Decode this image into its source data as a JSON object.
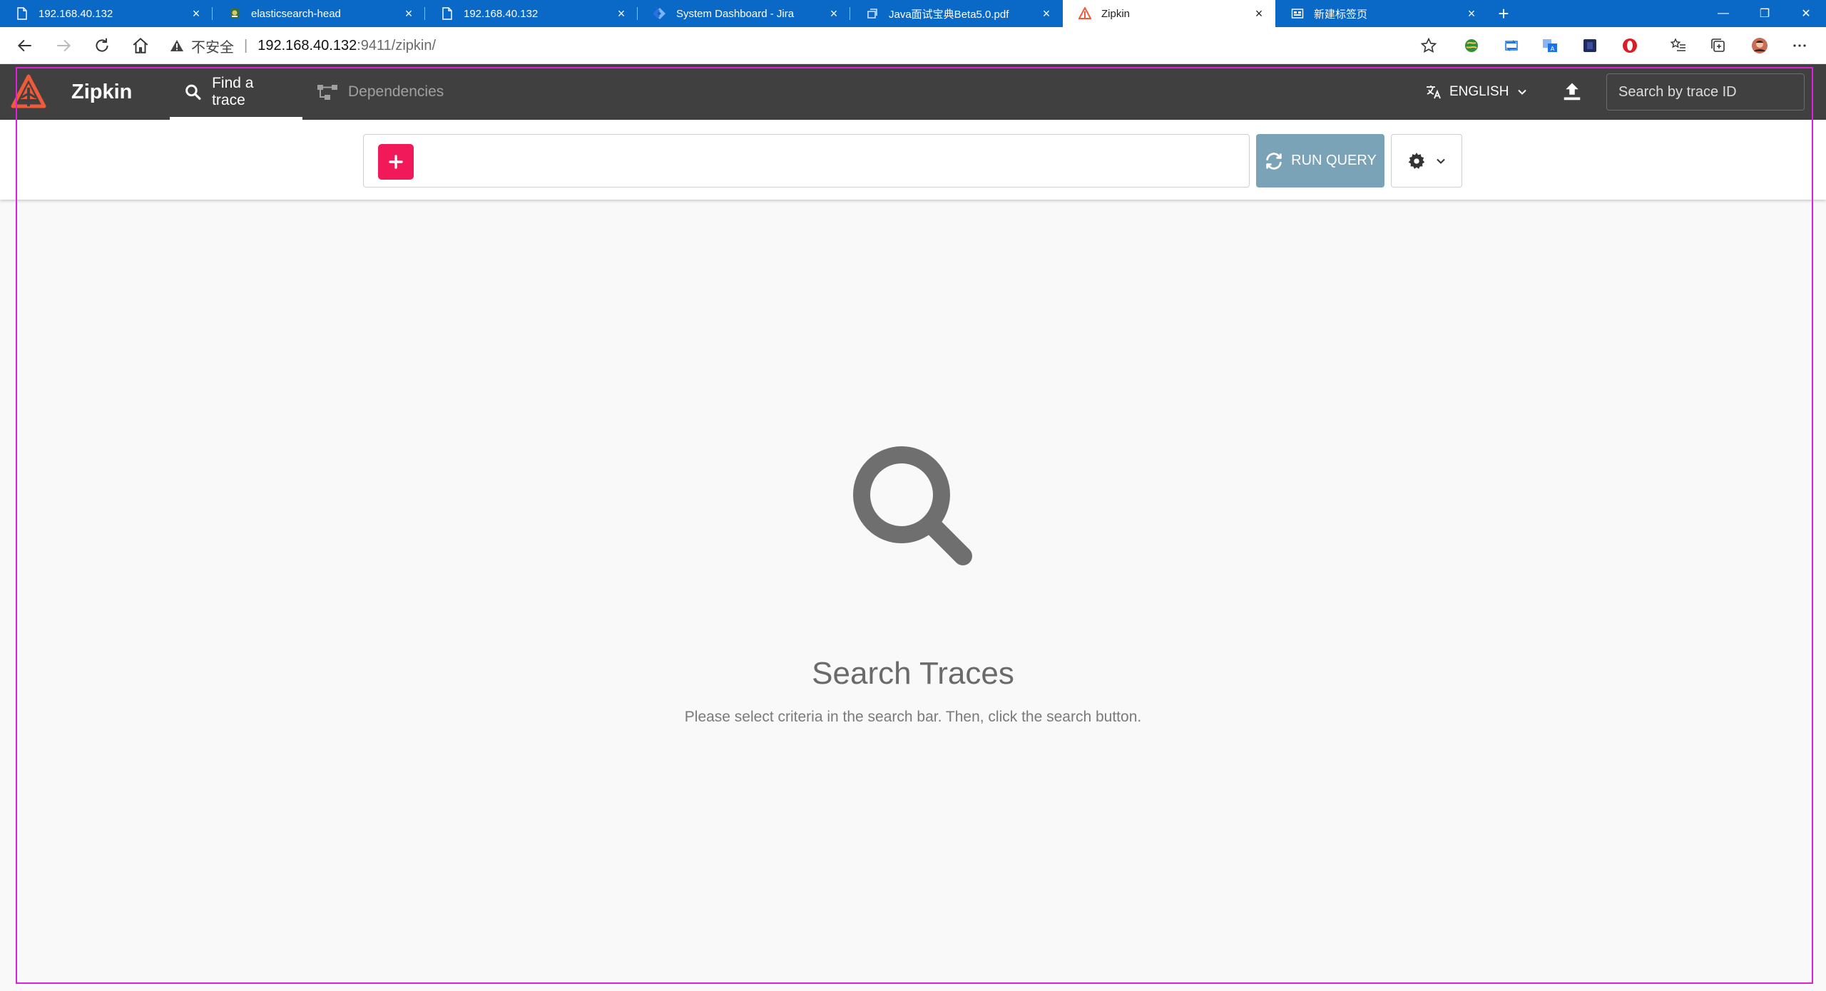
{
  "browser": {
    "tabs": [
      {
        "title": "192.168.40.132",
        "icon": "document-icon"
      },
      {
        "title": "elasticsearch-head",
        "icon": "elasticsearch-icon"
      },
      {
        "title": "192.168.40.132",
        "icon": "document-icon"
      },
      {
        "title": "System Dashboard - Jira",
        "icon": "jira-icon"
      },
      {
        "title": "Java面试宝典Beta5.0.pdf",
        "icon": "pdf-icon"
      },
      {
        "title": "Zipkin",
        "icon": "zipkin-icon",
        "active": true
      },
      {
        "title": "新建标签页",
        "icon": "newtab-page-icon"
      }
    ],
    "close_glyph": "×",
    "new_tab_glyph": "+",
    "window_controls": {
      "minimize": "—",
      "restore": "❐",
      "close": "✕"
    },
    "address": {
      "security_label": "不安全",
      "separator": "|",
      "host": "192.168.40.132",
      "path": ":9411/zipkin/"
    },
    "accent_color": "#0a68c7"
  },
  "app": {
    "brand": "Zipkin",
    "nav": {
      "find_trace": "Find a trace",
      "dependencies": "Dependencies"
    },
    "language": "ENGLISH",
    "trace_search_placeholder": "Search by trace ID",
    "search": {
      "add_glyph": "+",
      "run_query": "RUN QUERY"
    },
    "empty_state": {
      "title": "Search Traces",
      "subtitle": "Please select criteria in the search bar. Then, click the search button."
    },
    "colors": {
      "header": "#404040",
      "add_button": "#f2195a",
      "run_query": "#7aa3b8",
      "brand_logo": "#ef5b38"
    }
  }
}
